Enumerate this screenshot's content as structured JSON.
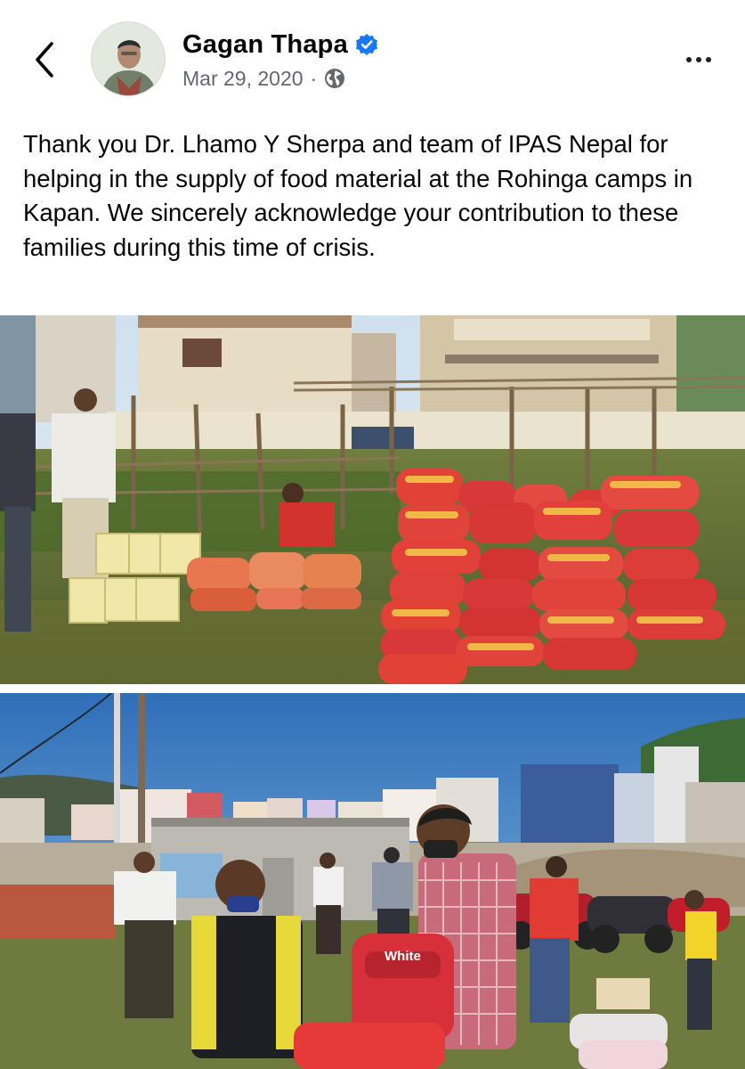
{
  "post": {
    "author": "Gagan Thapa",
    "verified": true,
    "date": "Mar 29, 2020",
    "separator": "·",
    "audience_icon": "globe-icon",
    "text": "Thank you Dr. Lhamo Y Sherpa and team of IPAS Nepal for helping in the supply of food material at the Rohinga camps in Kapan. We sincerely acknowledge your contribution to these families during this time of crisis.",
    "photos": [
      {
        "kind": "rice-sacks-and-boxes-in-yard"
      },
      {
        "kind": "men-distributing-bags-in-field",
        "bag_text": "White"
      }
    ]
  },
  "icons": {
    "back": "chevron-left-icon",
    "more": "more-horizontal-icon",
    "verified": "verified-badge-icon"
  },
  "colors": {
    "verified_blue": "#1877f2",
    "meta_gray": "#65676b",
    "sack_red": "#d8383a",
    "sack_yellow": "#f3c54a"
  }
}
